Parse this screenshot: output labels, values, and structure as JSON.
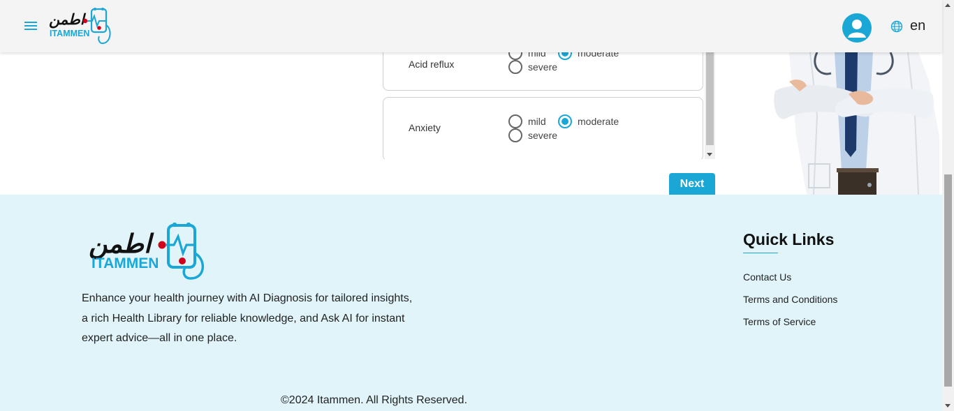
{
  "header": {
    "logo_arabic": "اطمن",
    "logo_latin": "ITAMMEN",
    "language": "en",
    "icons": {
      "menu": "hamburger-menu-icon",
      "user": "user-avatar-icon",
      "language": "globe-icon"
    }
  },
  "symptoms": [
    {
      "name": "Acid reflux",
      "options": [
        "mild",
        "moderate",
        "severe"
      ],
      "selected": "moderate"
    },
    {
      "name": "Anxiety",
      "options": [
        "mild",
        "moderate",
        "severe"
      ],
      "selected": "moderate"
    }
  ],
  "next_label": "Next",
  "footer": {
    "logo_arabic": "اطمن",
    "logo_latin": "ITAMMEN",
    "description": "Enhance your health journey with AI Diagnosis for tailored insights, a rich Health Library for reliable knowledge, and Ask AI for instant expert advice—all in one place.",
    "quick_links_title": "Quick Links",
    "links": [
      "Contact Us",
      "Terms and Conditions",
      "Terms of Service"
    ],
    "copyright": "©2024 Itammen. All Rights Reserved."
  },
  "colors": {
    "accent": "#1aa7d6",
    "footer_bg": "#e0f4f9",
    "logo_red": "#d0021b",
    "logo_dark": "#111111"
  }
}
